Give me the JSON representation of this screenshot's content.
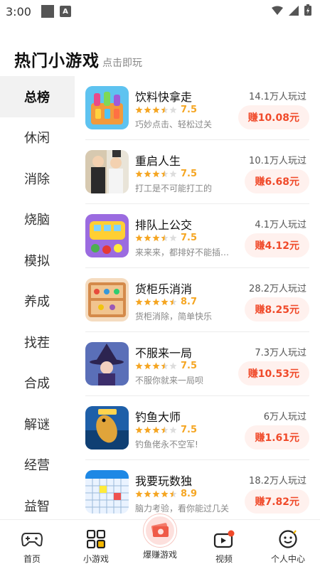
{
  "status": {
    "time": "3:00",
    "badge": "A"
  },
  "header": {
    "title": "热门小游戏",
    "subtitle": "点击即玩"
  },
  "categories": [
    "总榜",
    "休闲",
    "消除",
    "烧脑",
    "模拟",
    "养成",
    "找茬",
    "合成",
    "解谜",
    "经营",
    "益智"
  ],
  "active_category": "总榜",
  "games": [
    {
      "name": "饮料快拿走",
      "stars": 3.5,
      "score": "7.5",
      "desc": "巧妙点击、轻松过关",
      "players": "14.1万人玩过",
      "earn": "赚10.08元",
      "thumb": "drinks-game-thumbnail"
    },
    {
      "name": "重启人生",
      "stars": 3.5,
      "score": "7.5",
      "desc": "打工是不可能打工的",
      "players": "10.1万人玩过",
      "earn": "赚6.68元",
      "thumb": "life-restart-thumbnail"
    },
    {
      "name": "排队上公交",
      "stars": 3.5,
      "score": "7.5",
      "desc": "来来来，都排好不能插队…",
      "players": "4.1万人玩过",
      "earn": "赚4.12元",
      "thumb": "bus-queue-thumbnail"
    },
    {
      "name": "货柜乐消消",
      "stars": 4.5,
      "score": "8.7",
      "desc": "货柜消除，简单快乐",
      "players": "28.2万人玩过",
      "earn": "赚8.25元",
      "thumb": "cabinet-match-thumbnail"
    },
    {
      "name": "不服来一局",
      "stars": 3.5,
      "score": "7.5",
      "desc": "不服你就来一局呗",
      "players": "7.3万人玩过",
      "earn": "赚10.53元",
      "thumb": "witch-game-thumbnail"
    },
    {
      "name": "钓鱼大师",
      "stars": 3.5,
      "score": "7.5",
      "desc": "钓鱼佬永不空军!",
      "players": "6万人玩过",
      "earn": "赚1.61元",
      "thumb": "fishing-master-thumbnail"
    },
    {
      "name": "我要玩数独",
      "stars": 4.5,
      "score": "8.9",
      "desc": "脑力考验，看你能过几关",
      "players": "18.2万人玩过",
      "earn": "赚7.82元",
      "thumb": "sudoku-thumbnail"
    }
  ],
  "nav": [
    {
      "label": "首页",
      "icon": "gamepad-icon"
    },
    {
      "label": "小游戏",
      "icon": "grid-icon",
      "active": true
    },
    {
      "label": "爆赚游戏",
      "icon": "money-icon"
    },
    {
      "label": "视频",
      "icon": "video-icon"
    },
    {
      "label": "个人中心",
      "icon": "profile-icon"
    }
  ],
  "colors": {
    "accent": "#f04a2a",
    "star": "#f5a623",
    "earn_bg": "#fff1ee"
  }
}
